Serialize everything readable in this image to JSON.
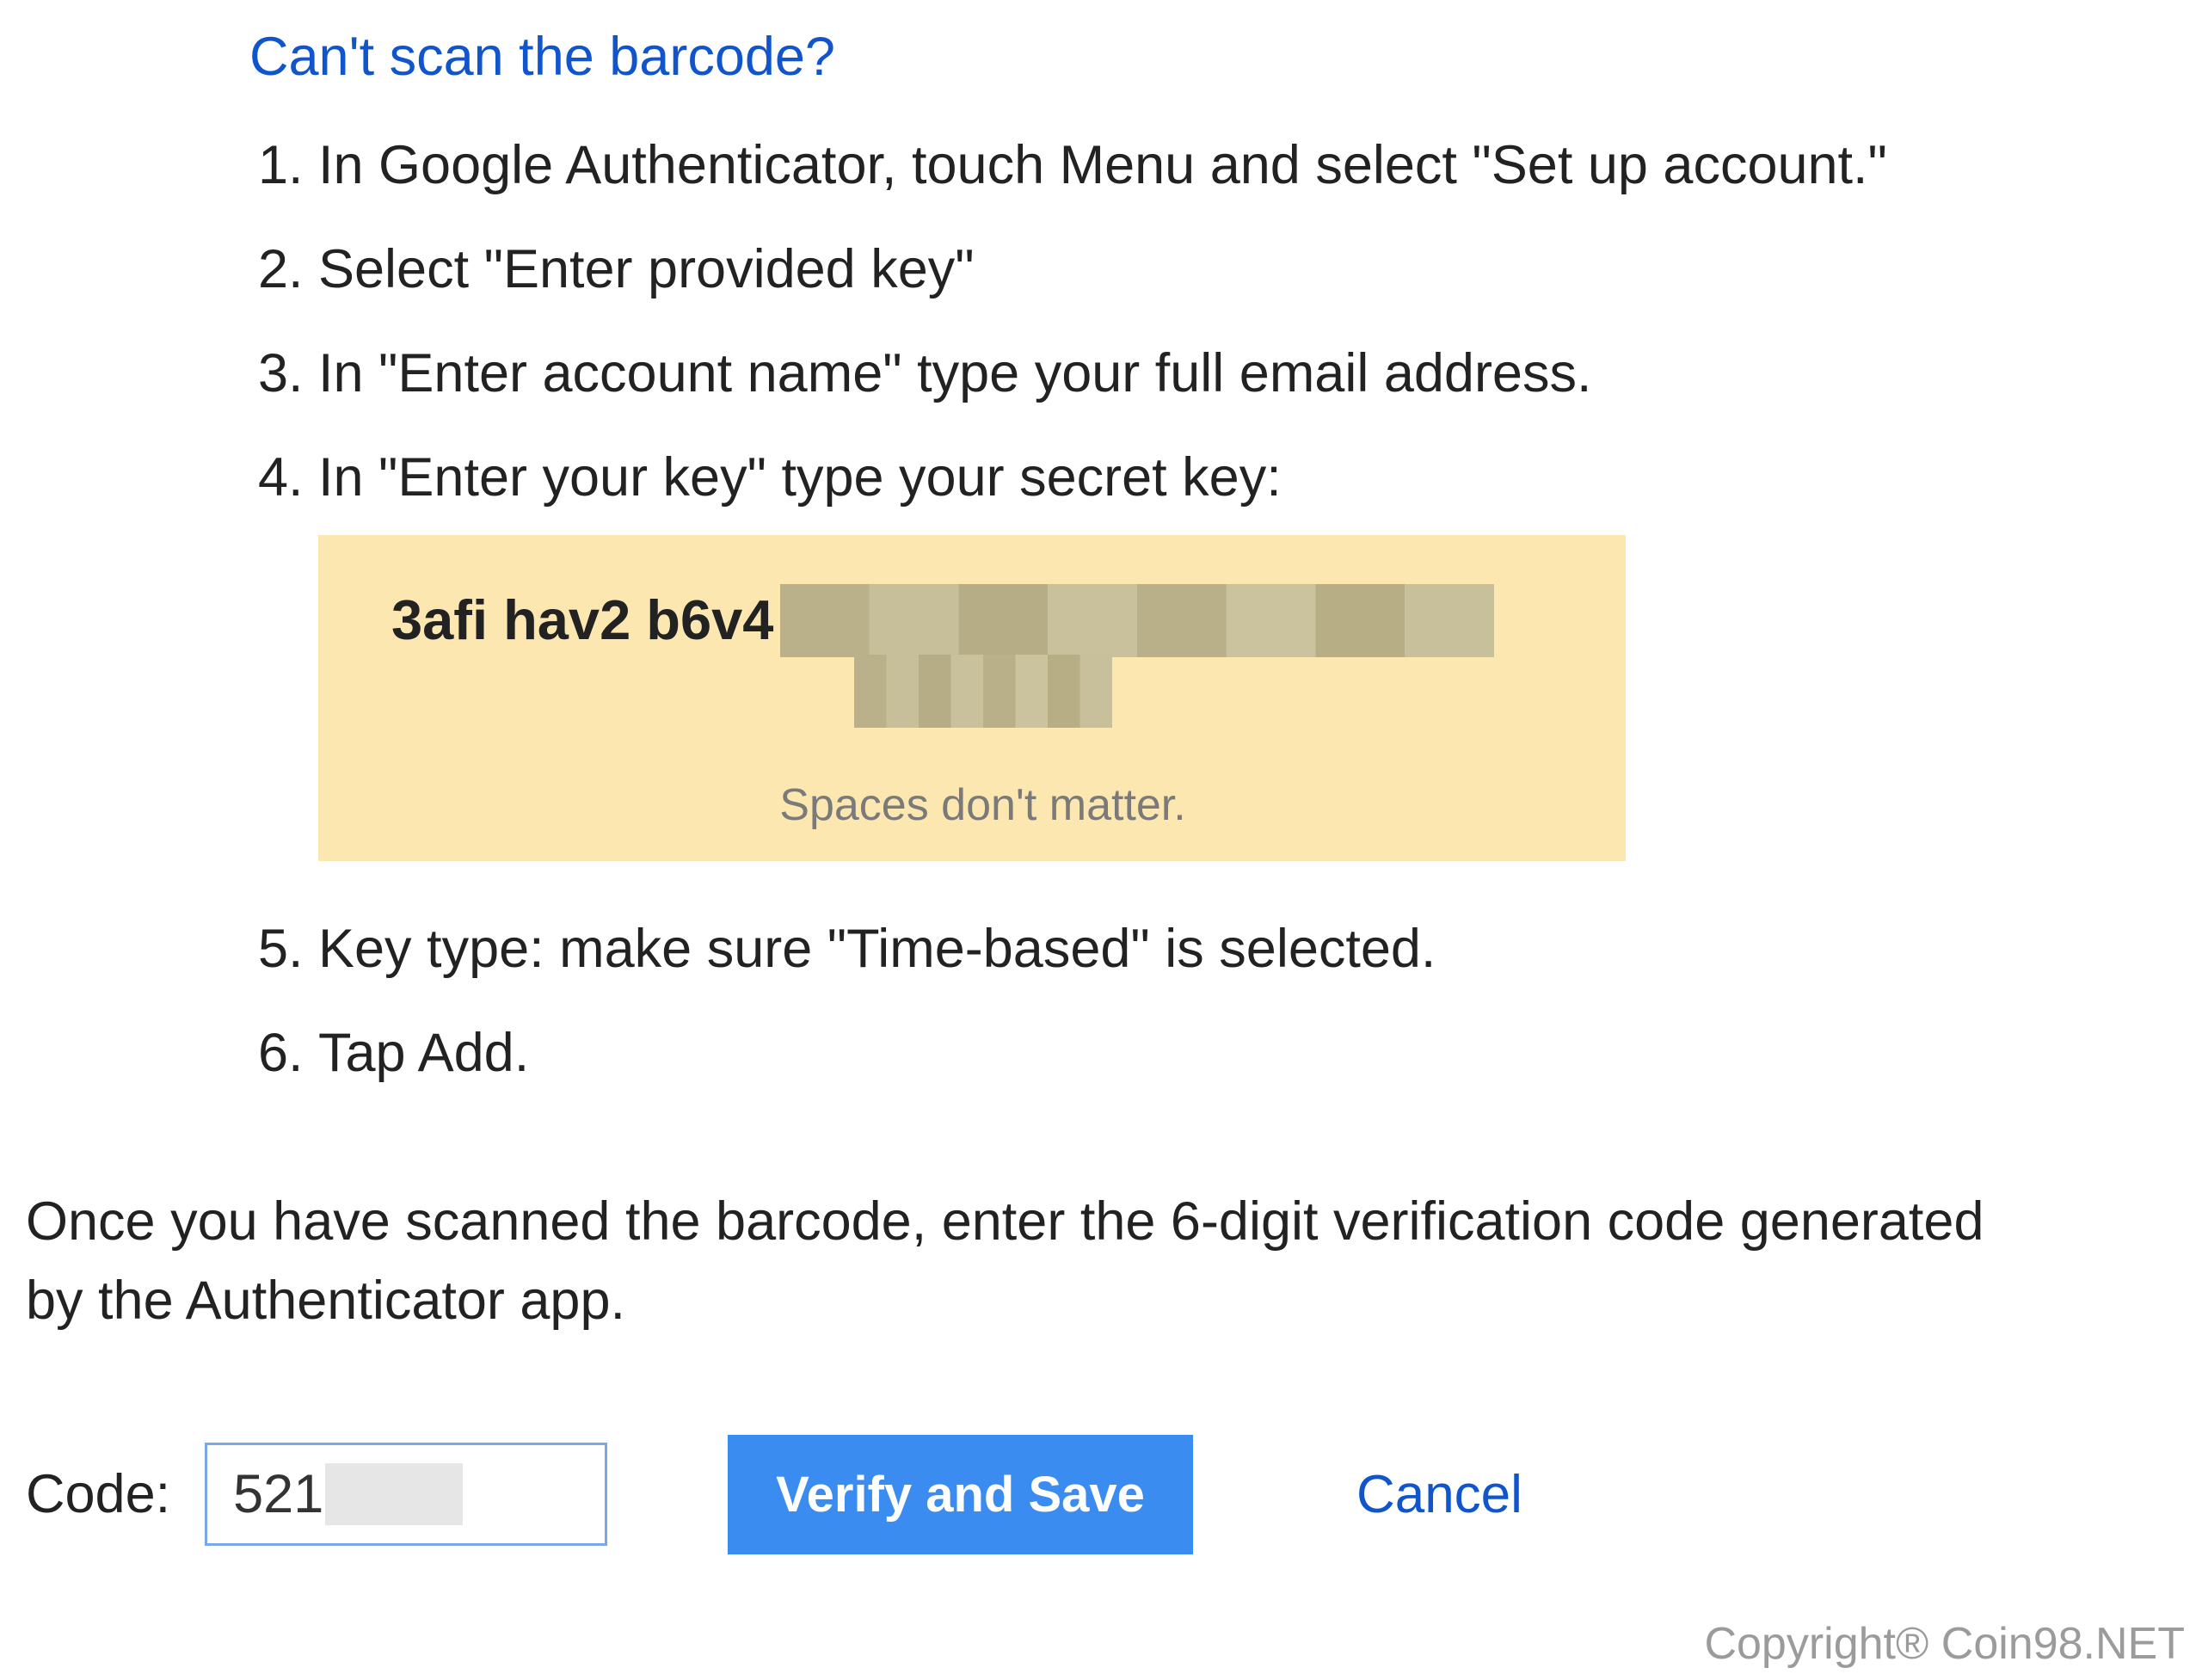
{
  "heading": "Can't scan the barcode?",
  "steps": {
    "s1": "In Google Authenticator, touch Menu and select \"Set up account.\"",
    "s2": "Select \"Enter provided key\"",
    "s3": "In \"Enter account name\" type your full email address.",
    "s4": "In \"Enter your key\" type your secret key:",
    "s5": "Key type: make sure \"Time-based\" is selected.",
    "s6": "Tap Add."
  },
  "secret_key_visible": "3afi hav2 b6v4",
  "spaces_note": "Spaces don't matter.",
  "instruction": "Once you have scanned the barcode, enter the 6-digit verification code generated by the Authenticator app.",
  "code_label": "Code:",
  "code_value_visible": "521",
  "verify_button": "Verify and Save",
  "cancel": "Cancel",
  "copyright": "Copyright® Coin98.NET"
}
